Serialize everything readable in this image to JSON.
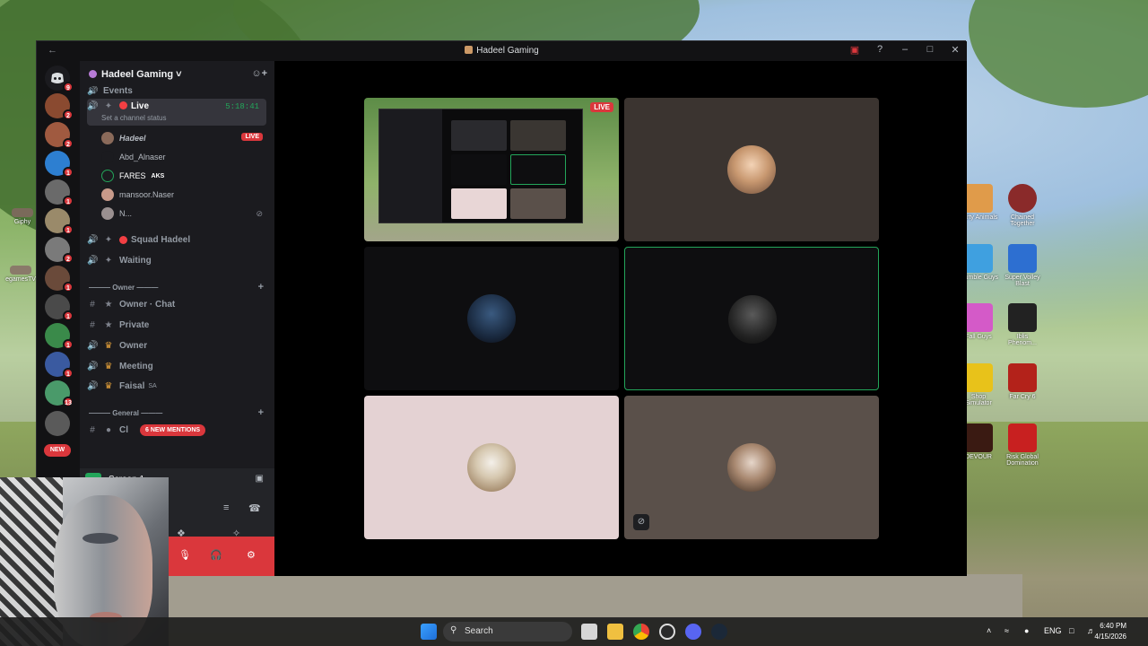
{
  "window": {
    "title": "Hadeel Gaming"
  },
  "servers": [
    {
      "badge": "9"
    },
    {
      "badge": "2"
    },
    {
      "badge": "2"
    },
    {
      "badge": "1"
    },
    {
      "badge": "1"
    },
    {
      "badge": "1"
    },
    {
      "badge": "2"
    },
    {
      "badge": "1"
    },
    {
      "badge": "1"
    },
    {
      "badge": "1"
    },
    {
      "badge": "1"
    },
    {
      "badge": "13"
    }
  ],
  "new_pill": "NEW",
  "guild": {
    "name": "Hadeel Gaming"
  },
  "channels": {
    "events": "Events",
    "live": {
      "name": "Live",
      "timer": "5:18:41",
      "status": "Set a channel status"
    },
    "members": [
      {
        "name": "Hadeel",
        "live": "LIVE"
      },
      {
        "name": "Abd_Alnaser"
      },
      {
        "name": "FARES",
        "tag": "AKS"
      },
      {
        "name": "mansoor.Naser"
      },
      {
        "name": "N..."
      }
    ],
    "squad": "Squad Hadeel",
    "waiting": "Waiting",
    "owner_category": "Owner",
    "owner_channels": [
      {
        "icon": "#",
        "name": "Owner · Chat"
      },
      {
        "icon": "#",
        "name": "Private"
      },
      {
        "icon": "speaker",
        "name": "Owner"
      },
      {
        "icon": "speaker",
        "name": "Meeting"
      },
      {
        "icon": "speaker",
        "name": "Faisal",
        "suffix": "SA"
      }
    ],
    "general_category": "General",
    "general_first": "Cl",
    "mentions": "6 NEW MENTIONS"
  },
  "stream_bar": {
    "label": "Screen 1"
  },
  "stage": {
    "live_badge": "LIVE"
  },
  "desktop_icons": [
    {
      "label": "Party Animals"
    },
    {
      "label": "Chained Together"
    },
    {
      "label": "Stumble Guys"
    },
    {
      "label": "Super Volley Blast"
    },
    {
      "label": "Fall Guys"
    },
    {
      "label": "Iblis Phenom..."
    },
    {
      "label": "Shop Simulator"
    },
    {
      "label": "Far Cry 6"
    },
    {
      "label": "DEVOUR"
    },
    {
      "label": "Risk Global Domination"
    }
  ],
  "left_desktop": [
    {
      "label": "Giphy"
    },
    {
      "label": "egamesTV"
    }
  ],
  "taskbar": {
    "search": "Search",
    "lang": "ENG",
    "time": "6:40 PM",
    "date": "4/15/2026"
  },
  "colors": {
    "accent": "#5865f2",
    "live": "#da373c",
    "online": "#23a55a"
  }
}
